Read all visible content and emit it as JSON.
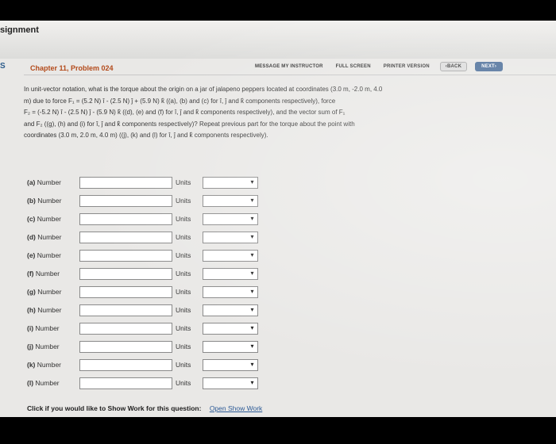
{
  "page": {
    "assignment_title": "signment",
    "side_label": "S"
  },
  "toolbar": {
    "message": "MESSAGE MY INSTRUCTOR",
    "full_screen": "FULL SCREEN",
    "printer": "PRINTER VERSION",
    "back": "‹BACK",
    "next": "NEXT›"
  },
  "chapter": "Chapter 11, Problem 024",
  "question": {
    "line1": "In unit-vector notation, what is the torque about the origin on a jar of jalapeno peppers located at coordinates (3.0 m, -2.0 m, 4.0",
    "line2": "m) due to force F₁ = (5.2 N) î - (2.5 N) ĵ + (5.9 N) k̂ ((a), (b) and (c) for î, ĵ and k̂ components respectively), force",
    "line3": "F₂ = (-5.2 N) î - (2.5 N) ĵ - (5.9 N) k̂ ((d), (e) and (f) for î, ĵ and k̂ components respectively), and the vector sum of F₁",
    "line4": "and F₂ ((g), (h) and (i) for î, ĵ and k̂ components respectively)? Repeat previous part for the torque about the point with",
    "line5": "coordinates (3.0 m, 2.0 m, 4.0 m) ((j), (k) and (l) for î, ĵ and k̂ components respectively)."
  },
  "form": {
    "number_label": "Number",
    "units_label": "Units",
    "rows": [
      {
        "id": "(a)"
      },
      {
        "id": "(b)"
      },
      {
        "id": "(c)"
      },
      {
        "id": "(d)"
      },
      {
        "id": "(e)"
      },
      {
        "id": "(f)"
      },
      {
        "id": "(g)"
      },
      {
        "id": "(h)"
      },
      {
        "id": "(i)"
      },
      {
        "id": "(j)"
      },
      {
        "id": "(k)"
      },
      {
        "id": "(l)"
      }
    ]
  },
  "show_work": {
    "prompt": "Click if you would like to Show Work for this question:",
    "link": "Open Show Work"
  }
}
